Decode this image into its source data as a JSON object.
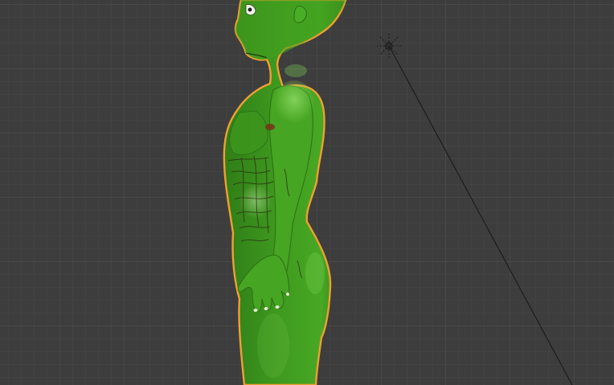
{
  "viewport": {
    "background": "#3d3d3d",
    "grid_minor_color": "#474747",
    "grid_major_color": "#525252"
  },
  "model": {
    "label": "",
    "skin_color": "#3f9a1f",
    "shadow_color": "#2a6d14",
    "highlight_color": "#7dcf55",
    "outline_color": "#f0a030",
    "pattern_color": "#2d2a12"
  },
  "light": {
    "icon": "sun-light-icon",
    "color": "#1a1a1a"
  }
}
